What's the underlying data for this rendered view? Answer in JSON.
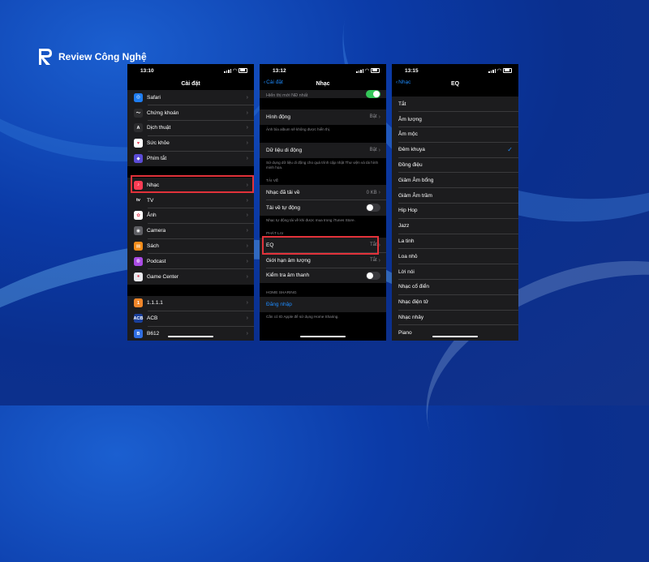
{
  "brand": {
    "name": "Review Công Nghệ"
  },
  "screen1": {
    "time": "13:10",
    "title": "Cài đặt",
    "group_a": [
      {
        "label": "Safari",
        "color": "#1e7cf0",
        "glyph": "◎"
      },
      {
        "label": "Chứng khoán",
        "color": "#2c2c2e",
        "glyph": "〜"
      },
      {
        "label": "Dịch thuật",
        "color": "#2c2c2e",
        "glyph": "A"
      },
      {
        "label": "Sức khỏe",
        "color": "#ffffff",
        "glyph": "♥"
      },
      {
        "label": "Phím tắt",
        "color": "#5b4bd6",
        "glyph": "◆"
      }
    ],
    "group_b": [
      {
        "label": "Nhạc",
        "color": "#fa3c54",
        "glyph": "♪"
      },
      {
        "label": "TV",
        "color": "#1c1c1e",
        "glyph": "tv"
      },
      {
        "label": "Ảnh",
        "color": "#ffffff",
        "glyph": "✿"
      },
      {
        "label": "Camera",
        "color": "#5f5f64",
        "glyph": "◉"
      },
      {
        "label": "Sách",
        "color": "#f28c1a",
        "glyph": "▤"
      },
      {
        "label": "Podcast",
        "color": "#a94be3",
        "glyph": "◍"
      },
      {
        "label": "Game Center",
        "color": "#e8e8ec",
        "glyph": "●"
      }
    ],
    "group_c": [
      {
        "label": "1.1.1.1",
        "color": "#f0862a",
        "glyph": "1"
      },
      {
        "label": "ACB",
        "color": "#1a3f9a",
        "glyph": "ACB"
      },
      {
        "label": "B612",
        "color": "#2f6de1",
        "glyph": "B"
      }
    ]
  },
  "screen2": {
    "time": "13:12",
    "back": "Cài đặt",
    "title": "Nhạc",
    "top_row": "Hiển thị mới NĐ nhất",
    "hinh_dong": {
      "label": "Hình động",
      "value": "Bật"
    },
    "hinh_dong_footer": "Ảnh bìa album sẽ không được hiển thị.",
    "du_lieu": {
      "label": "Dữ liệu di động",
      "value": "Bật"
    },
    "du_lieu_footer": "Sử dụng dữ liệu di động cho quá trình cập nhật Thư viện và tải hình minh họa.",
    "section_tai_ve": "TẢI VỀ",
    "nhac_da_tai": {
      "label": "Nhạc đã tải về",
      "value": "0 KB"
    },
    "tai_tu_dong": {
      "label": "Tải về tự động"
    },
    "tai_footer": "Nhạc tự động tải về khi được mua trong iTunes Store.",
    "section_phat_lai": "PHÁT LẠI",
    "eq": {
      "label": "EQ",
      "value": "Tắt"
    },
    "gioi_han": {
      "label": "Giới hạn âm lượng",
      "value": "Tắt"
    },
    "kiem_tra": {
      "label": "Kiểm tra âm thanh"
    },
    "section_home": "HOME SHARING",
    "dang_nhap": "Đăng nhập",
    "home_footer": "Cần có ID Apple để sử dụng Home Sharing."
  },
  "screen3": {
    "time": "13:15",
    "back": "Nhạc",
    "title": "EQ",
    "options": [
      "Tắt",
      "Âm lượng",
      "Âm mộc",
      "Đêm khuya",
      "Đồng điệu",
      "Giảm Âm bổng",
      "Giảm Âm trầm",
      "Hip Hop",
      "Jazz",
      "La tinh",
      "Loa nhỏ",
      "Lời nói",
      "Nhạc cổ điển",
      "Nhạc điện tử",
      "Nhạc nhảy",
      "Piano"
    ],
    "selected": "Đêm khuya"
  }
}
